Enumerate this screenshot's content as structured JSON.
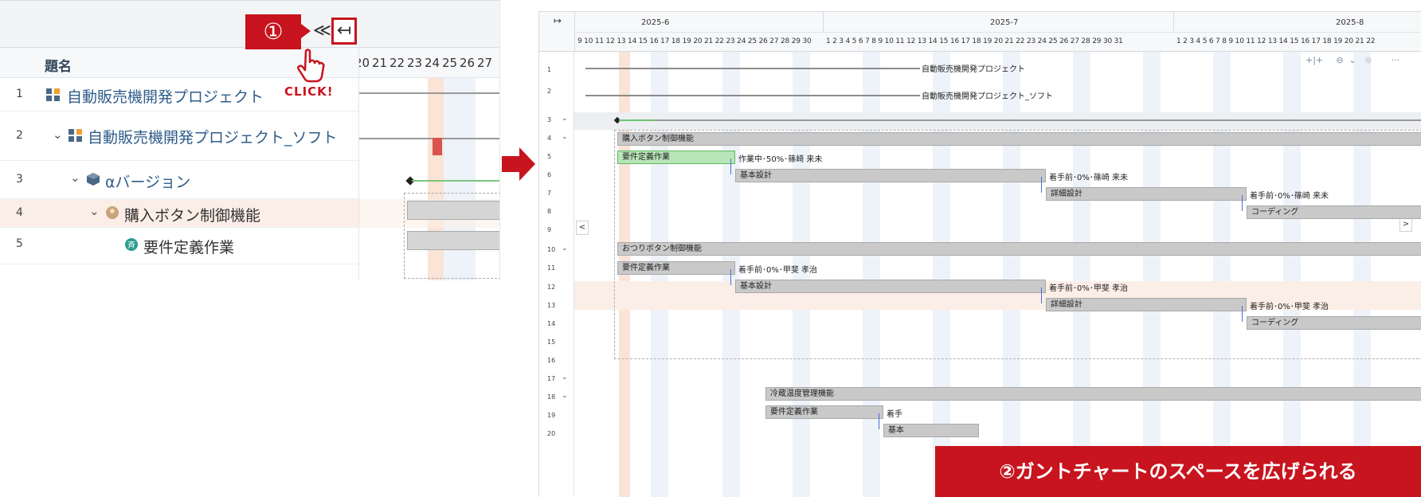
{
  "left": {
    "annotation_number": "①",
    "collapse_label": "≪",
    "collapse_full_label": "↤",
    "click_text": "CLICK!",
    "column_title": "題名",
    "day_labels": [
      "20",
      "21",
      "22",
      "23",
      "24",
      "25",
      "26",
      "27"
    ],
    "rows": [
      {
        "num": "1",
        "label": "自動販売機開発プロジェクト"
      },
      {
        "num": "2",
        "label": "自動販売機開発プロジェクト_ソフト"
      },
      {
        "num": "3",
        "label": "αバージョン"
      },
      {
        "num": "4",
        "label": "購入ボタン制御機能"
      },
      {
        "num": "5",
        "label": "要件定義作業"
      }
    ]
  },
  "gantt": {
    "expand_label": "↦",
    "months": [
      "2025-6",
      "2025-7",
      "2025-8"
    ],
    "days_june": "9 10 11 12 13 14 15 16 17 18 19 20 21 22 23 24 25 26 27 28 29 30",
    "days_july": "1 2 3 4 5 6 7 8 9 10 11 12 13 14 15 16 17 18 19 20 21 22 23 24 25 26 27 28 29 30 31",
    "days_aug": "1 2 3 4 5 6 7 8 9 10 11 12 13 14 15 16 17 18 19 20 21 22",
    "row_numbers": [
      "1",
      "2",
      "3",
      "4",
      "5",
      "6",
      "7",
      "8",
      "9",
      "10",
      "11",
      "12",
      "13",
      "14",
      "15",
      "16",
      "17",
      "18",
      "19",
      "20"
    ],
    "rows": {
      "r1": "自動販売機開発プロジェクト",
      "r2": "自動販売機開発プロジェクト_ソフト",
      "r4": "購入ボタン制御機能",
      "r5_bar": "要件定義作業",
      "r5_status": "作業中･50%･篠崎 来未",
      "r6_bar": "基本設計",
      "r6_status": "着手前･0%･篠崎 来未",
      "r7_bar": "詳細設計",
      "r7_status": "着手前･0%･篠崎 来未",
      "r8_bar": "コーディング",
      "r10": "おつりボタン制御機能",
      "r11_bar": "要件定義作業",
      "r11_status": "着手前･0%･甲斐 孝治",
      "r12_bar": "基本設計",
      "r12_status": "着手前･0%･甲斐 孝治",
      "r13_bar": "詳細設計",
      "r13_status": "着手前･0%･甲斐 孝治",
      "r14_bar": "コーディング",
      "r18": "冷蔵温度管理機能",
      "r19_bar": "要件定義作業",
      "r19_status": "着手",
      "r20_bar": "基本"
    },
    "toolbar": {
      "fit": "+|+",
      "zoom_out": "⊖",
      "dropdown": "⌄",
      "zoom_in": "⊕",
      "more": "···"
    },
    "scroll_left": "<",
    "scroll_right": ">"
  },
  "banner_text": "②ガントチャートのスペースを広げられる"
}
